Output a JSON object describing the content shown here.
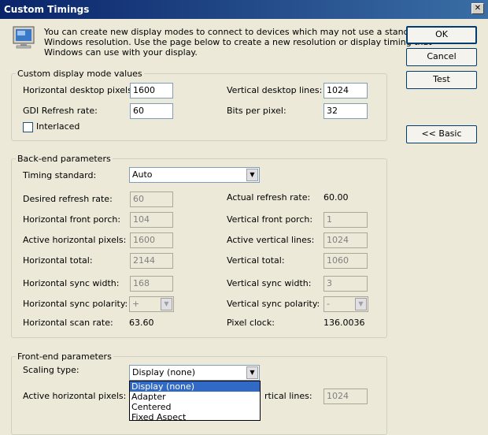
{
  "window": {
    "title": "Custom Timings",
    "close_glyph": "✕"
  },
  "intro_text": [
    "You can create new display modes to connect to devices which may not use a standard",
    "Windows resolution. Use the page below to create a new resolution or display timing that",
    "Windows can use with your display."
  ],
  "buttons": {
    "ok": "OK",
    "cancel": "Cancel",
    "test": "Test",
    "basic": "<< Basic"
  },
  "custom_mode": {
    "title": "Custom display mode values",
    "h_pixels_label": "Horizontal desktop pixels:",
    "h_pixels_value": "1600",
    "v_lines_label": "Vertical desktop lines:",
    "v_lines_value": "1024",
    "gdi_label": "GDI Refresh rate:",
    "gdi_value": "60",
    "bpp_label": "Bits per pixel:",
    "bpp_value": "32",
    "interlaced_label": "Interlaced"
  },
  "backend": {
    "title": "Back-end parameters",
    "timing_label": "Timing standard:",
    "timing_value": "Auto",
    "desired_refresh_label": "Desired refresh rate:",
    "desired_refresh_value": "60",
    "actual_refresh_label": "Actual refresh rate:",
    "actual_refresh_value": "60.00",
    "h_front_porch_label": "Horizontal front porch:",
    "h_front_porch_value": "104",
    "v_front_porch_label": "Vertical front porch:",
    "v_front_porch_value": "1",
    "active_h_label": "Active horizontal pixels:",
    "active_h_value": "1600",
    "active_v_label": "Active vertical lines:",
    "active_v_value": "1024",
    "h_total_label": "Horizontal total:",
    "h_total_value": "2144",
    "v_total_label": "Vertical total:",
    "v_total_value": "1060",
    "h_sync_width_label": "Horizontal sync width:",
    "h_sync_width_value": "168",
    "v_sync_width_label": "Vertical sync width:",
    "v_sync_width_value": "3",
    "h_sync_pol_label": "Horizontal sync polarity:",
    "h_sync_pol_value": "+",
    "v_sync_pol_label": "Vertical sync polarity:",
    "v_sync_pol_value": "-",
    "h_scan_label": "Horizontal scan rate:",
    "h_scan_value": "63.60",
    "pixel_clock_label": "Pixel clock:",
    "pixel_clock_value": "136.0036"
  },
  "frontend": {
    "title": "Front-end parameters",
    "scaling_label": "Scaling type:",
    "scaling_value": "Display (none)",
    "active_h_label": "Active horizontal pixels:",
    "active_v_label_partial": "rtical lines:",
    "active_v_value": "1024",
    "scaling_options": [
      "Display (none)",
      "Adapter",
      "Centered",
      "Fixed Aspect"
    ]
  },
  "colors": {
    "titlebar_start": "#0a246a",
    "titlebar_end": "#3a6ea5",
    "selection": "#316ac5",
    "dialog_bg": "#ece9d8"
  }
}
